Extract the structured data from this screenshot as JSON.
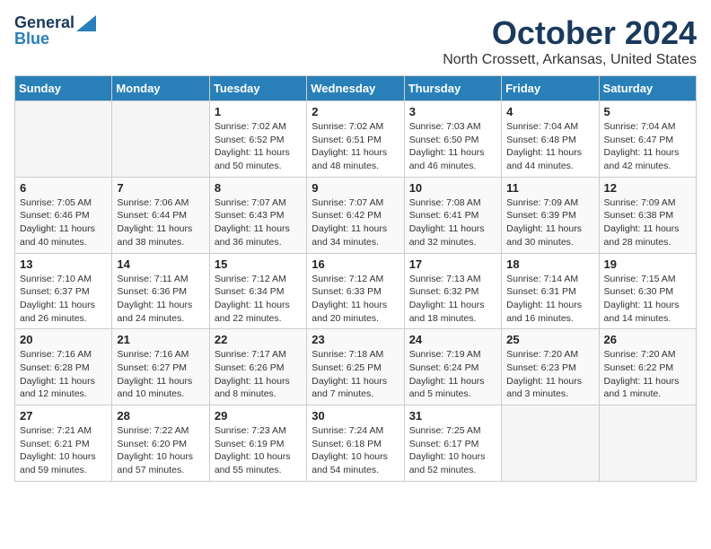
{
  "logo": {
    "general": "General",
    "blue": "Blue"
  },
  "header": {
    "month": "October 2024",
    "location": "North Crossett, Arkansas, United States"
  },
  "weekdays": [
    "Sunday",
    "Monday",
    "Tuesday",
    "Wednesday",
    "Thursday",
    "Friday",
    "Saturday"
  ],
  "weeks": [
    [
      {
        "day": "",
        "info": ""
      },
      {
        "day": "",
        "info": ""
      },
      {
        "day": "1",
        "info": "Sunrise: 7:02 AM\nSunset: 6:52 PM\nDaylight: 11 hours and 50 minutes."
      },
      {
        "day": "2",
        "info": "Sunrise: 7:02 AM\nSunset: 6:51 PM\nDaylight: 11 hours and 48 minutes."
      },
      {
        "day": "3",
        "info": "Sunrise: 7:03 AM\nSunset: 6:50 PM\nDaylight: 11 hours and 46 minutes."
      },
      {
        "day": "4",
        "info": "Sunrise: 7:04 AM\nSunset: 6:48 PM\nDaylight: 11 hours and 44 minutes."
      },
      {
        "day": "5",
        "info": "Sunrise: 7:04 AM\nSunset: 6:47 PM\nDaylight: 11 hours and 42 minutes."
      }
    ],
    [
      {
        "day": "6",
        "info": "Sunrise: 7:05 AM\nSunset: 6:46 PM\nDaylight: 11 hours and 40 minutes."
      },
      {
        "day": "7",
        "info": "Sunrise: 7:06 AM\nSunset: 6:44 PM\nDaylight: 11 hours and 38 minutes."
      },
      {
        "day": "8",
        "info": "Sunrise: 7:07 AM\nSunset: 6:43 PM\nDaylight: 11 hours and 36 minutes."
      },
      {
        "day": "9",
        "info": "Sunrise: 7:07 AM\nSunset: 6:42 PM\nDaylight: 11 hours and 34 minutes."
      },
      {
        "day": "10",
        "info": "Sunrise: 7:08 AM\nSunset: 6:41 PM\nDaylight: 11 hours and 32 minutes."
      },
      {
        "day": "11",
        "info": "Sunrise: 7:09 AM\nSunset: 6:39 PM\nDaylight: 11 hours and 30 minutes."
      },
      {
        "day": "12",
        "info": "Sunrise: 7:09 AM\nSunset: 6:38 PM\nDaylight: 11 hours and 28 minutes."
      }
    ],
    [
      {
        "day": "13",
        "info": "Sunrise: 7:10 AM\nSunset: 6:37 PM\nDaylight: 11 hours and 26 minutes."
      },
      {
        "day": "14",
        "info": "Sunrise: 7:11 AM\nSunset: 6:36 PM\nDaylight: 11 hours and 24 minutes."
      },
      {
        "day": "15",
        "info": "Sunrise: 7:12 AM\nSunset: 6:34 PM\nDaylight: 11 hours and 22 minutes."
      },
      {
        "day": "16",
        "info": "Sunrise: 7:12 AM\nSunset: 6:33 PM\nDaylight: 11 hours and 20 minutes."
      },
      {
        "day": "17",
        "info": "Sunrise: 7:13 AM\nSunset: 6:32 PM\nDaylight: 11 hours and 18 minutes."
      },
      {
        "day": "18",
        "info": "Sunrise: 7:14 AM\nSunset: 6:31 PM\nDaylight: 11 hours and 16 minutes."
      },
      {
        "day": "19",
        "info": "Sunrise: 7:15 AM\nSunset: 6:30 PM\nDaylight: 11 hours and 14 minutes."
      }
    ],
    [
      {
        "day": "20",
        "info": "Sunrise: 7:16 AM\nSunset: 6:28 PM\nDaylight: 11 hours and 12 minutes."
      },
      {
        "day": "21",
        "info": "Sunrise: 7:16 AM\nSunset: 6:27 PM\nDaylight: 11 hours and 10 minutes."
      },
      {
        "day": "22",
        "info": "Sunrise: 7:17 AM\nSunset: 6:26 PM\nDaylight: 11 hours and 8 minutes."
      },
      {
        "day": "23",
        "info": "Sunrise: 7:18 AM\nSunset: 6:25 PM\nDaylight: 11 hours and 7 minutes."
      },
      {
        "day": "24",
        "info": "Sunrise: 7:19 AM\nSunset: 6:24 PM\nDaylight: 11 hours and 5 minutes."
      },
      {
        "day": "25",
        "info": "Sunrise: 7:20 AM\nSunset: 6:23 PM\nDaylight: 11 hours and 3 minutes."
      },
      {
        "day": "26",
        "info": "Sunrise: 7:20 AM\nSunset: 6:22 PM\nDaylight: 11 hours and 1 minute."
      }
    ],
    [
      {
        "day": "27",
        "info": "Sunrise: 7:21 AM\nSunset: 6:21 PM\nDaylight: 10 hours and 59 minutes."
      },
      {
        "day": "28",
        "info": "Sunrise: 7:22 AM\nSunset: 6:20 PM\nDaylight: 10 hours and 57 minutes."
      },
      {
        "day": "29",
        "info": "Sunrise: 7:23 AM\nSunset: 6:19 PM\nDaylight: 10 hours and 55 minutes."
      },
      {
        "day": "30",
        "info": "Sunrise: 7:24 AM\nSunset: 6:18 PM\nDaylight: 10 hours and 54 minutes."
      },
      {
        "day": "31",
        "info": "Sunrise: 7:25 AM\nSunset: 6:17 PM\nDaylight: 10 hours and 52 minutes."
      },
      {
        "day": "",
        "info": ""
      },
      {
        "day": "",
        "info": ""
      }
    ]
  ]
}
